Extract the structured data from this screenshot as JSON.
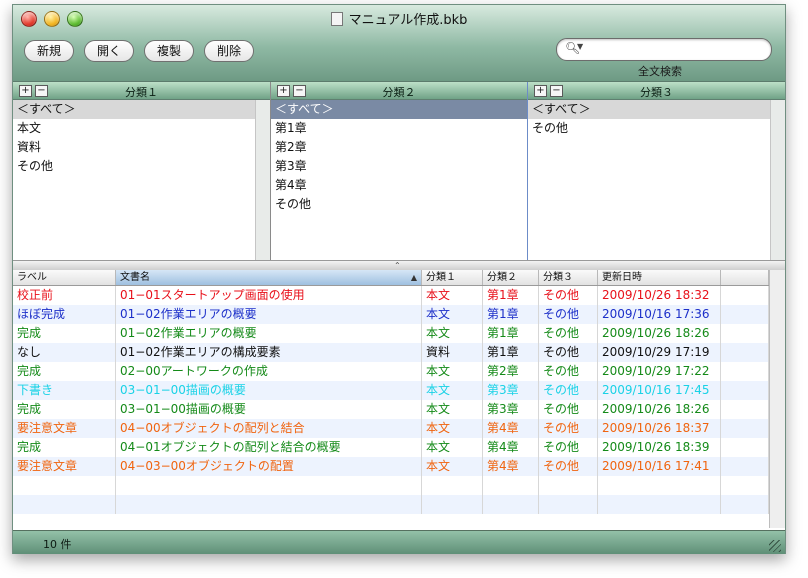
{
  "window": {
    "title": "マニュアル作成.bkb"
  },
  "toolbar": {
    "buttons": [
      "新規",
      "開く",
      "複製",
      "削除"
    ],
    "search_placeholder": "",
    "search_label": "全文検索"
  },
  "panes": [
    {
      "header": "分類１",
      "items": [
        "＜すべて＞",
        "本文",
        "資料",
        "その他"
      ],
      "selected": 0
    },
    {
      "header": "分類２",
      "items": [
        "＜すべて＞",
        "第1章",
        "第2章",
        "第3章",
        "第4章",
        "その他"
      ],
      "selected": 0
    },
    {
      "header": "分類３",
      "items": [
        "＜すべて＞",
        "その他"
      ],
      "selected": 0
    }
  ],
  "pane_controls": {
    "add": "+",
    "remove": "−"
  },
  "table": {
    "columns": [
      "ラベル",
      "文書名",
      "分類１",
      "分類２",
      "分類３",
      "更新日時"
    ],
    "sorted_column": "文書名",
    "sort_indicator": "▲",
    "rows": [
      {
        "label": "校正前",
        "name": "01−01スタートアップ画面の使用",
        "c1": "本文",
        "c2": "第1章",
        "c3": "その他",
        "date": "2009/10/26 18:32",
        "color": "#e8101a"
      },
      {
        "label": "ほぼ完成",
        "name": "01−02作業エリアの概要",
        "c1": "本文",
        "c2": "第1章",
        "c3": "その他",
        "date": "2009/10/16 17:36",
        "color": "#1c2fc9"
      },
      {
        "label": "完成",
        "name": "01−02作業エリアの概要",
        "c1": "本文",
        "c2": "第1章",
        "c3": "その他",
        "date": "2009/10/26 18:26",
        "color": "#148a18"
      },
      {
        "label": "なし",
        "name": "01−02作業エリアの構成要素",
        "c1": "資料",
        "c2": "第1章",
        "c3": "その他",
        "date": "2009/10/29 17:19",
        "color": "#111111"
      },
      {
        "label": "完成",
        "name": "02−00アートワークの作成",
        "c1": "本文",
        "c2": "第2章",
        "c3": "その他",
        "date": "2009/10/29 17:22",
        "color": "#148a18"
      },
      {
        "label": "下書き",
        "name": "03−01−00描画の概要",
        "c1": "本文",
        "c2": "第3章",
        "c3": "その他",
        "date": "2009/10/16 17:45",
        "color": "#19d2e6"
      },
      {
        "label": "完成",
        "name": "03−01−00描画の概要",
        "c1": "本文",
        "c2": "第3章",
        "c3": "その他",
        "date": "2009/10/26 18:26",
        "color": "#148a18"
      },
      {
        "label": "要注意文章",
        "name": "04−00オブジェクトの配列と結合",
        "c1": "本文",
        "c2": "第4章",
        "c3": "その他",
        "date": "2009/10/26 18:37",
        "color": "#f0640f"
      },
      {
        "label": "完成",
        "name": "04−01オブジェクトの配列と結合の概要",
        "c1": "本文",
        "c2": "第4章",
        "c3": "その他",
        "date": "2009/10/26 18:39",
        "color": "#148a18"
      },
      {
        "label": "要注意文章",
        "name": "04−03−00オブジェクトの配置",
        "c1": "本文",
        "c2": "第4章",
        "c3": "その他",
        "date": "2009/10/16 17:41",
        "color": "#f0640f"
      }
    ]
  },
  "status": {
    "count": "10 件"
  }
}
